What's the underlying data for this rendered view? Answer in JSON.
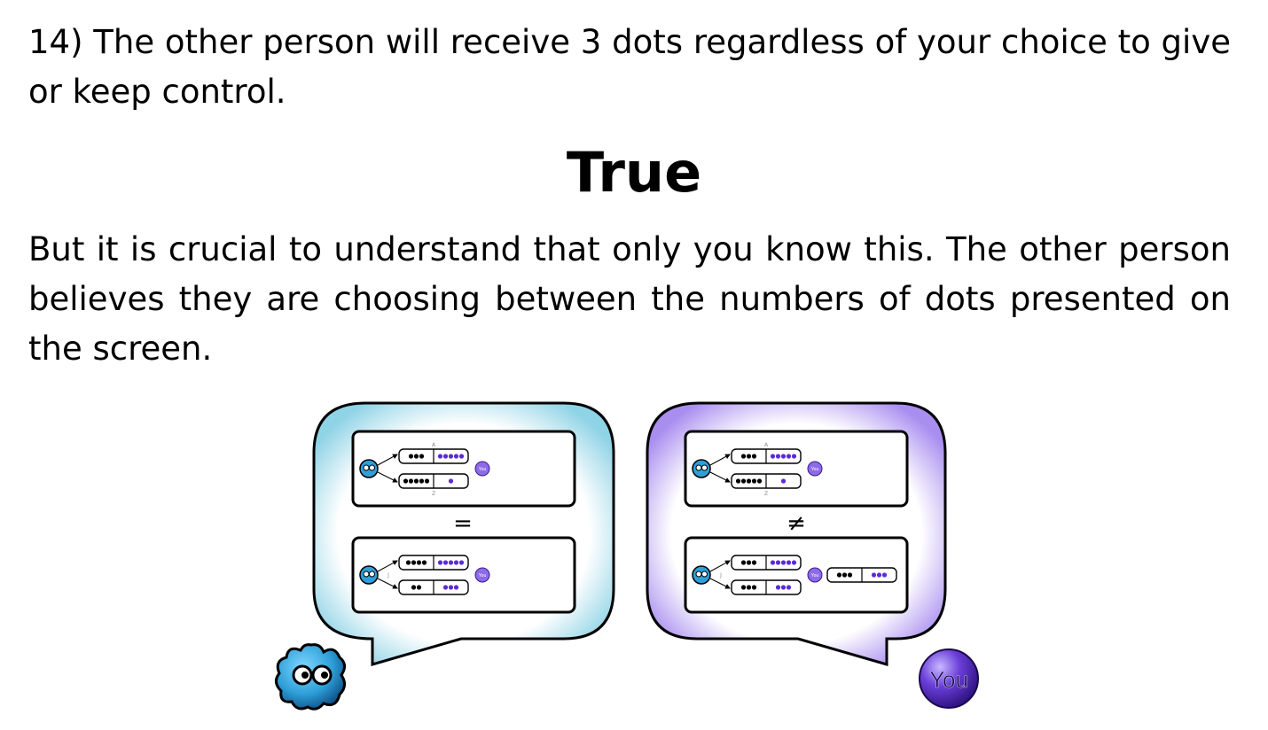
{
  "question": "14) The other person will receive 3 dots regardless of your choice to give or keep control.",
  "answer": "True",
  "explanation": "But it is crucial to understand that only you know this.  The other person believes they are choosing between the numbers of dots presented on the screen.",
  "illustration": {
    "left_bubble": {
      "relation_symbol": "=",
      "top_panel": {
        "upper_option": {
          "other_dots": 3,
          "your_dots": 5
        },
        "lower_option": {
          "other_dots": 5,
          "your_dots": 1
        },
        "key_upper": "A",
        "key_lower": "Z"
      },
      "bottom_panel": {
        "upper_option": {
          "other_dots": 4,
          "your_dots": 5
        },
        "lower_option": {
          "other_dots": 2,
          "your_dots": 3
        },
        "key_upper": "J",
        "key_lower": "K"
      }
    },
    "right_bubble": {
      "relation_symbol": "≠",
      "top_panel": {
        "upper_option": {
          "other_dots": 3,
          "your_dots": 5
        },
        "lower_option": {
          "other_dots": 5,
          "your_dots": 1
        },
        "key_upper": "A",
        "key_lower": "Z"
      },
      "bottom_panel": {
        "upper_option": {
          "other_dots": 3,
          "your_dots": 5
        },
        "lower_option": {
          "other_dots": 3,
          "your_dots": 3
        },
        "key_upper": "J",
        "key_lower": "K",
        "result_option": {
          "other_dots": 3,
          "your_dots": 3
        }
      }
    },
    "you_label": "You",
    "colors": {
      "left_bubble_glow": "#8fd3e6",
      "right_bubble_glow": "#a98ef0",
      "your_dot": "#5a2bd6",
      "other_dot": "#000000",
      "creature": "#2e9fd8",
      "you_avatar": "#5b2dc2"
    }
  }
}
